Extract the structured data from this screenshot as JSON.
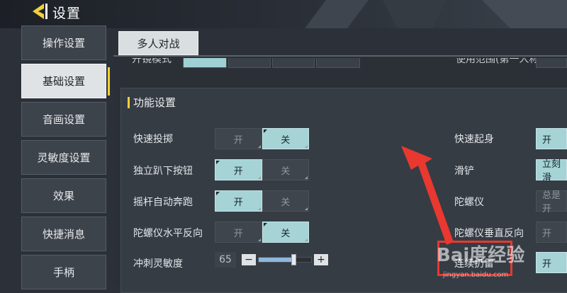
{
  "header": {
    "title": "设置",
    "back_icon": "back-chevron-icon",
    "accent": "#f2d13a"
  },
  "sidebar": {
    "items": [
      {
        "label": "操作设置",
        "active": false
      },
      {
        "label": "基础设置",
        "active": true
      },
      {
        "label": "音画设置",
        "active": false
      },
      {
        "label": "灵敏度设置",
        "active": false
      },
      {
        "label": "效果",
        "active": false
      },
      {
        "label": "快捷消息",
        "active": false
      },
      {
        "label": "手柄",
        "active": false
      }
    ]
  },
  "tabs": [
    {
      "label": "多人对战",
      "active": true
    }
  ],
  "cut_row": {
    "left_label": "开镜模式",
    "right_label": "使用范围(第一人称)"
  },
  "section": {
    "title": "功能设置"
  },
  "left_settings": [
    {
      "label": "快速投掷",
      "on": "开",
      "off": "关",
      "selected": "关"
    },
    {
      "label": "独立趴下按钮",
      "on": "开",
      "off": "关",
      "selected": "开"
    },
    {
      "label": "摇杆自动奔跑",
      "on": "开",
      "off": "关",
      "selected": "开"
    },
    {
      "label": "陀螺仪水平反向",
      "on": "开",
      "off": "关",
      "selected": "关"
    }
  ],
  "sprint_sensitivity": {
    "label": "冲刺灵敏度",
    "value": "65",
    "minus": "−",
    "plus": "+",
    "fraction": 0.65
  },
  "right_settings": [
    {
      "label": "快速起身",
      "value": "开",
      "state": "on"
    },
    {
      "label": "滑铲",
      "value": "立刻滑",
      "state": "on"
    },
    {
      "label": "陀螺仪",
      "value": "总是开",
      "state": "off"
    },
    {
      "label": "陀螺仪垂直反向",
      "value": "开",
      "state": "off"
    },
    {
      "label": "连续扔雷",
      "value": "开",
      "state": "on"
    }
  ],
  "watermark": {
    "brand": "Bai度经验",
    "url": "jingyan.baidu.com"
  },
  "annotation_color": "#e8382f"
}
